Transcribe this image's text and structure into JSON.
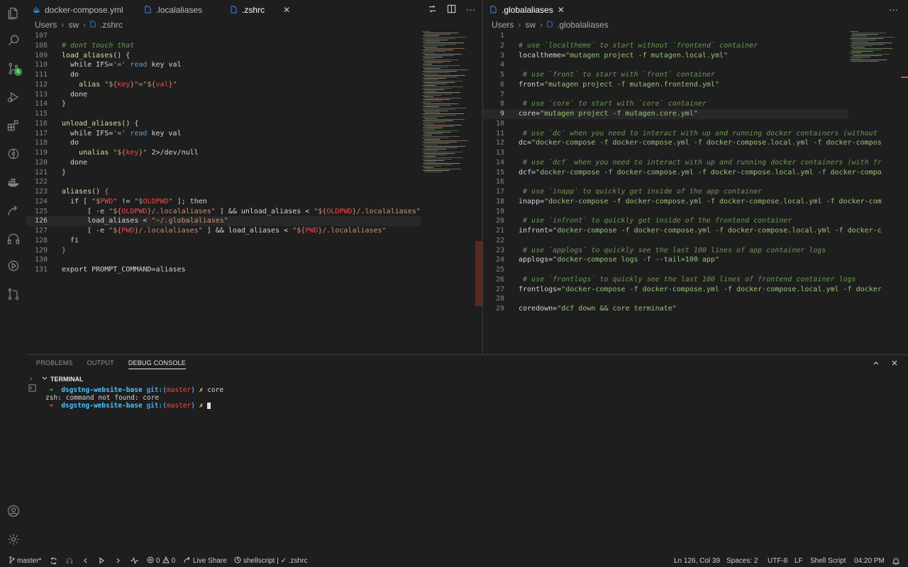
{
  "left_group": {
    "tabs": [
      {
        "label": "docker-compose.yml",
        "icon": "docker-icon"
      },
      {
        "label": ".localaliases",
        "icon": "file-icon"
      },
      {
        "label": ".zshrc",
        "icon": "file-icon",
        "active": true
      }
    ],
    "close": "✕",
    "breadcrumb": [
      "Users",
      "sw",
      ".zshrc"
    ]
  },
  "right_group": {
    "tabs": [
      {
        "label": ".globalaliases",
        "icon": "file-icon",
        "active": true
      }
    ],
    "close": "✕",
    "breadcrumb": [
      "Users",
      "sw",
      ".globalaliases"
    ]
  },
  "more_actions": "···",
  "panel": {
    "tabs": [
      "PROBLEMS",
      "OUTPUT",
      "DEBUG CONSOLE"
    ],
    "terminal_label": "TERMINAL",
    "terminal": {
      "arrow": "➜",
      "dir": "dsgstng-website-base",
      "git": "git:(",
      "branch": "master",
      "git_close": ")",
      "dirty": "✗",
      "command": "core",
      "error": "zsh: command not found: core"
    }
  },
  "status": {
    "branch": "master*",
    "errors": "0",
    "warnings": "0",
    "live_share": "Live Share",
    "language_mode": "shellscript | ✓ .zshrc",
    "cursor": "Ln 126, Col 39",
    "spaces": "Spaces: 2",
    "encoding": "UTF-8",
    "eol": "LF",
    "language": "Shell Script",
    "time": "04:20 PM"
  },
  "colors": {
    "background": "#1e1e1e",
    "comment": "#6a9955",
    "function": "#dcdcaa",
    "string": "#ce9178",
    "keyword": "#c586c0",
    "variable": "#f44747",
    "alias_value": "#98c379",
    "git_badge": "#2ea043"
  },
  "activity_badge": "6"
}
